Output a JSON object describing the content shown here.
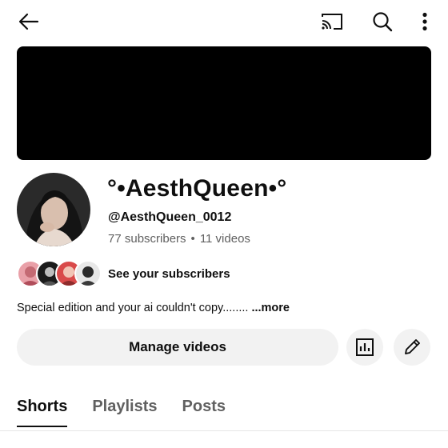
{
  "header": {
    "icons": [
      "back-arrow-icon",
      "cast-icon",
      "search-icon",
      "more-vert-icon"
    ]
  },
  "channel": {
    "name": "°•AesthQueen•°",
    "handle": "@AesthQueen_0012",
    "subscribers": "77 subscribers",
    "separator": "•",
    "videos": "11 videos",
    "see_subscribers_label": "See your subscribers",
    "description": "Special edition and your ai couldn't copy........",
    "more_label": "...more"
  },
  "actions": {
    "manage_videos_label": "Manage videos",
    "analytics_icon": "analytics-icon",
    "edit_icon": "pencil-icon"
  },
  "tabs": [
    {
      "label": "Shorts",
      "active": true
    },
    {
      "label": "Playlists",
      "active": false
    },
    {
      "label": "Posts",
      "active": false
    }
  ],
  "colors": {
    "text_primary": "#0f0f0f",
    "text_secondary": "#606060",
    "button_bg": "#f2f2f2",
    "banner": "#000000"
  }
}
